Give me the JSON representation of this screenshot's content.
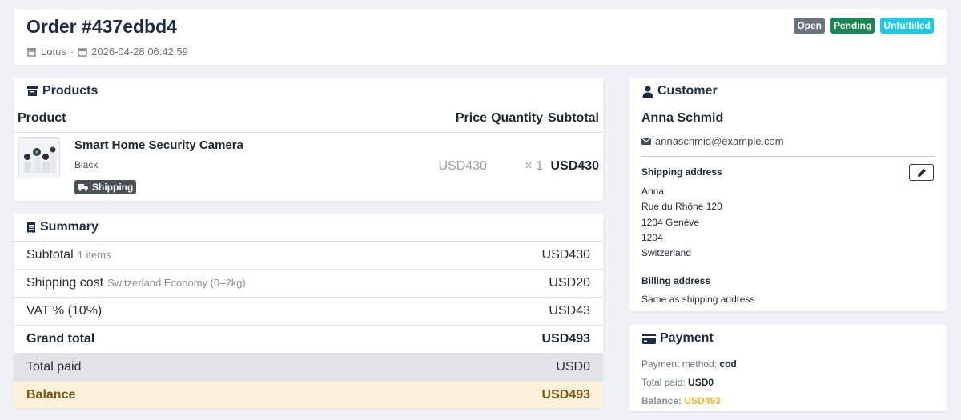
{
  "header": {
    "title": "Order #437edbd4",
    "store": "Lotus",
    "separator": "·",
    "datetime": "2026-04-28 06:42:59",
    "badges": [
      {
        "label": "Open",
        "color": "#6c757d"
      },
      {
        "label": "Pending",
        "color": "#198754"
      },
      {
        "label": "Unfulfilled",
        "color": "#1fc8e3"
      }
    ]
  },
  "products": {
    "title": "Products",
    "columns": {
      "product": "Product",
      "price": "Price",
      "quantity": "Quantity",
      "subtotal": "Subtotal"
    },
    "items": [
      {
        "name": "Smart Home Security Camera",
        "variant": "Black",
        "badge": "Shipping",
        "price": "USD430",
        "quantity": "× 1",
        "subtotal": "USD430"
      }
    ]
  },
  "summary": {
    "title": "Summary",
    "subtotal": {
      "label": "Subtotal",
      "note": "1 items",
      "value": "USD430"
    },
    "shipping": {
      "label": "Shipping cost",
      "note": "Switzerland Economy (0–2kg)",
      "value": "USD20"
    },
    "vat": {
      "label": "VAT % (10%)",
      "value": "USD43"
    },
    "grand_total": {
      "label": "Grand total",
      "value": "USD493"
    },
    "total_paid": {
      "label": "Total paid",
      "value": "USD0"
    },
    "balance": {
      "label": "Balance",
      "value": "USD493"
    }
  },
  "customer": {
    "title": "Customer",
    "name": "Anna Schmid",
    "email": "annaschmid@example.com",
    "shipping_heading": "Shipping address",
    "shipping_lines": [
      "Anna",
      "Rue du Rhône 120",
      "1204 Genève",
      "1204",
      "Switzerland"
    ],
    "billing_heading": "Billing address",
    "billing_text": "Same as shipping address"
  },
  "payment": {
    "title": "Payment",
    "method_label": "Payment method:",
    "method_value": "cod",
    "paid_label": "Total paid:",
    "paid_value": "USD0",
    "balance_label": "Balance:",
    "balance_value": "USD493"
  },
  "colors": {
    "balance_accent": "#e8b633",
    "balance_bg": "#fdf1d9",
    "paid_bg": "#e2e3e5"
  }
}
